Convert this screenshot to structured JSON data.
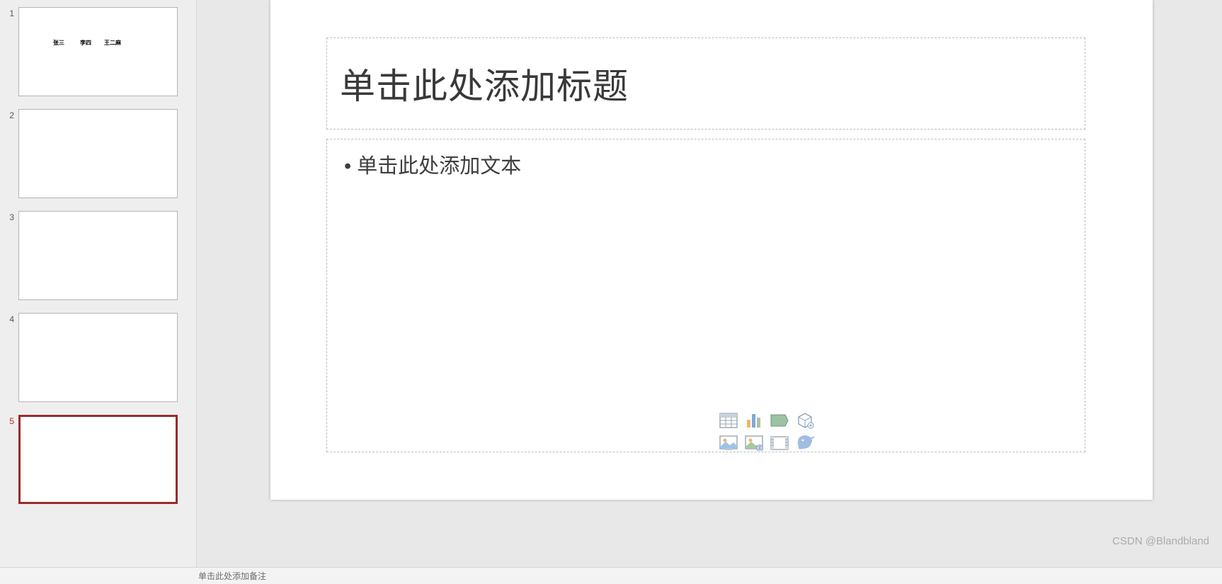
{
  "thumbnails": {
    "items": [
      {
        "num": "1",
        "selected": false,
        "mini": [
          "张三",
          "李四",
          "王二麻"
        ]
      },
      {
        "num": "2",
        "selected": false,
        "mini": []
      },
      {
        "num": "3",
        "selected": false,
        "mini": []
      },
      {
        "num": "4",
        "selected": false,
        "mini": []
      },
      {
        "num": "5",
        "selected": true,
        "mini": []
      }
    ]
  },
  "slide": {
    "title_placeholder": "单击此处添加标题",
    "body_placeholder": "• 单击此处添加文本",
    "icons": {
      "table": "table-icon",
      "chart": "chart-icon",
      "smartart": "smartart-icon",
      "model3d": "model3d-icon",
      "picture": "picture-icon",
      "online_picture": "online-picture-icon",
      "video": "video-icon",
      "icon": "icon-icon"
    }
  },
  "notes": {
    "placeholder": "单击此处添加备注"
  },
  "watermark": "CSDN @Blandbland"
}
